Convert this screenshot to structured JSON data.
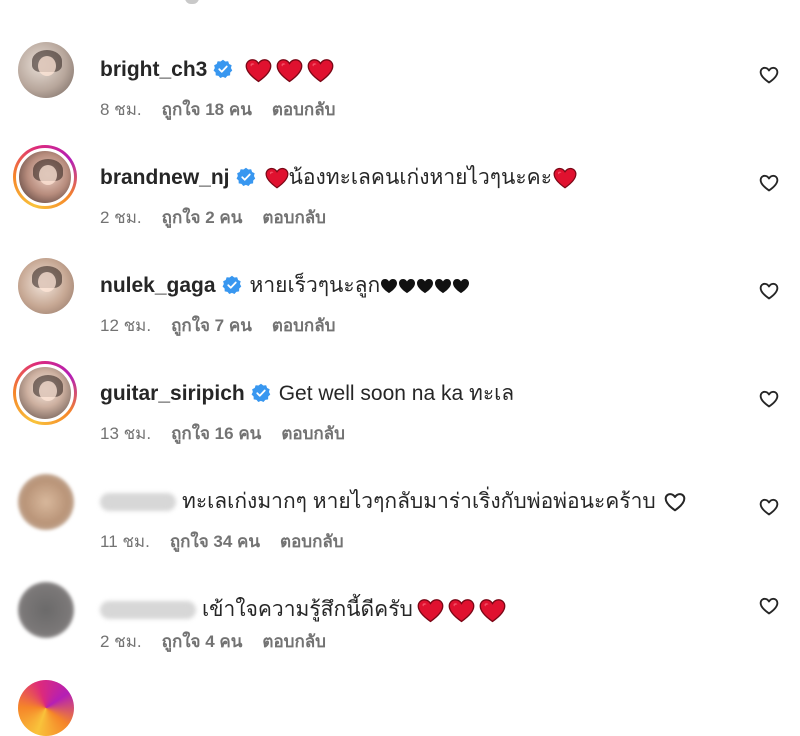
{
  "colors": {
    "verified": "#3897f0",
    "heart_red": "#e0112f",
    "meta_gray": "#737373",
    "text": "#262626"
  },
  "icons": {
    "verified": "verified-badge-icon",
    "like": "heart-outline-icon",
    "emoji_heart": "red-heart-emoji-icon",
    "emoji_black_heart": "black-heart-emoji-icon"
  },
  "comments": [
    {
      "username": "bright_ch3",
      "verified": true,
      "text": "",
      "time": "8 ชม.",
      "likes": "ถูกใจ 18 คน",
      "reply": "ตอบกลับ"
    },
    {
      "username": "brandnew_nj",
      "verified": true,
      "text": "น้องทะเลคนเก่งหายไวๆนะคะ",
      "time": "2 ชม.",
      "likes": "ถูกใจ 2 คน",
      "reply": "ตอบกลับ"
    },
    {
      "username": "nulek_gaga",
      "verified": true,
      "text": "หายเร็วๆนะลูก",
      "time": "12 ชม.",
      "likes": "ถูกใจ 7 คน",
      "reply": "ตอบกลับ"
    },
    {
      "username": "guitar_siripich",
      "verified": true,
      "text": "Get well soon na ka ทะเล",
      "time": "13 ชม.",
      "likes": "ถูกใจ 16 คน",
      "reply": "ตอบกลับ"
    },
    {
      "username": "",
      "verified": false,
      "text": "ทะเลเก่งมากๆ หายไวๆกลับมาร่าเริ่งกับพ่อพ่อนะคร้าบ",
      "time": "11 ชม.",
      "likes": "ถูกใจ 34 คน",
      "reply": "ตอบกลับ"
    },
    {
      "username": "",
      "verified": false,
      "text": "เข้าใจความรู้สึกนี้ดีครับ",
      "time": "2 ชม.",
      "likes": "ถูกใจ 4 คน",
      "reply": "ตอบกลับ"
    }
  ]
}
